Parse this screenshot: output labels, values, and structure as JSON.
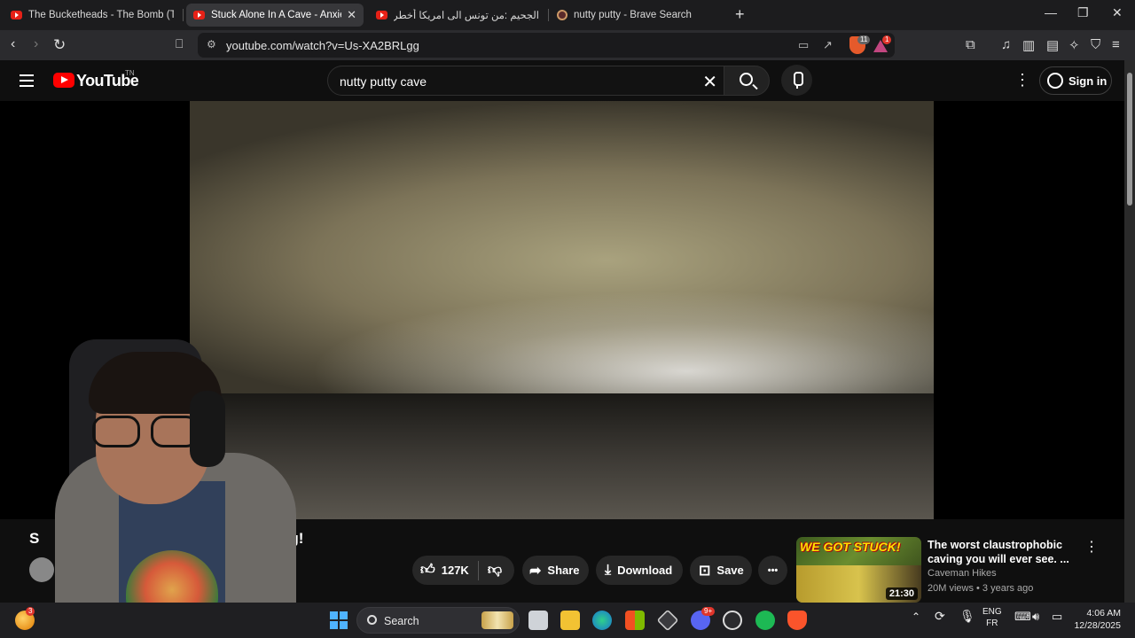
{
  "browser": {
    "tabs": [
      {
        "title": "The Bucketheads - The Bomb (These",
        "active": false
      },
      {
        "title": "Stuck Alone In A Cave - Anxiety I",
        "active": true
      },
      {
        "title": "الجحيم :من تونس الى امريكا أخطر طرق",
        "active": false
      },
      {
        "title": "nutty putty - Brave Search",
        "active": false
      }
    ],
    "close_tab": "✕",
    "new_tab": "+",
    "window_controls": [
      "—",
      "❐",
      "✕"
    ],
    "url": "youtube.com/watch?v=Us-XA2BRLgg",
    "shield_count": "11",
    "rewards_count": "1"
  },
  "youtube": {
    "logo_text": "YouTube",
    "country_code": "TN",
    "search_query": "nutty putty cave",
    "clear_icon": "✕",
    "sign_in": "Sign in",
    "video_title_start": "S",
    "video_title_end": "ng!",
    "actions": {
      "likes": "127K",
      "share": "Share",
      "download": "Download",
      "save": "Save",
      "more": "•••"
    },
    "recommended": {
      "thumb_text": "WE GOT STUCK!",
      "duration": "21:30",
      "title": "The worst claustrophobic caving you will ever see. ...",
      "channel": "Caveman Hikes",
      "stats": "20M views • 3 years ago"
    }
  },
  "taskbar": {
    "search_label": "Search",
    "lang_top": "ENG",
    "lang_bottom": "FR",
    "time": "4:06 AM",
    "date": "12/28/2025",
    "weather_badge": "3",
    "discord_badge": "9+"
  }
}
